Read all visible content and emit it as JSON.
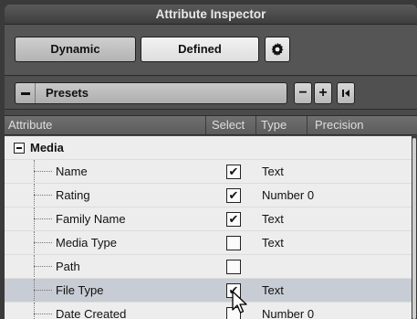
{
  "window": {
    "title": "Attribute Inspector"
  },
  "toolbar": {
    "dynamic_label": "Dynamic",
    "defined_label": "Defined",
    "settings_icon": "gear-icon"
  },
  "presets": {
    "label": "Presets",
    "remove_label": "−",
    "add_label": "+",
    "reset_icon": "skip-to-start-icon"
  },
  "columns": {
    "attribute": "Attribute",
    "select": "Select",
    "type": "Type",
    "precision": "Precision"
  },
  "tree": {
    "group": {
      "label": "Media",
      "expanded": true
    },
    "items": [
      {
        "label": "Name",
        "checked": true,
        "check": "✔",
        "type": "Text",
        "selected": false
      },
      {
        "label": "Rating",
        "checked": true,
        "check": "✔",
        "type": "Number 0",
        "selected": false
      },
      {
        "label": "Family Name",
        "checked": true,
        "check": "✔",
        "type": "Text",
        "selected": false
      },
      {
        "label": "Media Type",
        "checked": false,
        "check": "",
        "type": "Text",
        "selected": false
      },
      {
        "label": "Path",
        "checked": false,
        "check": "",
        "type": "",
        "selected": false
      },
      {
        "label": "File Type",
        "checked": true,
        "check": "✔",
        "type": "Text",
        "selected": true
      },
      {
        "label": "Date Created",
        "checked": false,
        "check": "",
        "type": "Number 0",
        "selected": false
      }
    ]
  },
  "colors": {
    "panel_bg": "#4a4a4a",
    "list_bg": "#ededed",
    "selected_row": "#c8ccd4"
  }
}
